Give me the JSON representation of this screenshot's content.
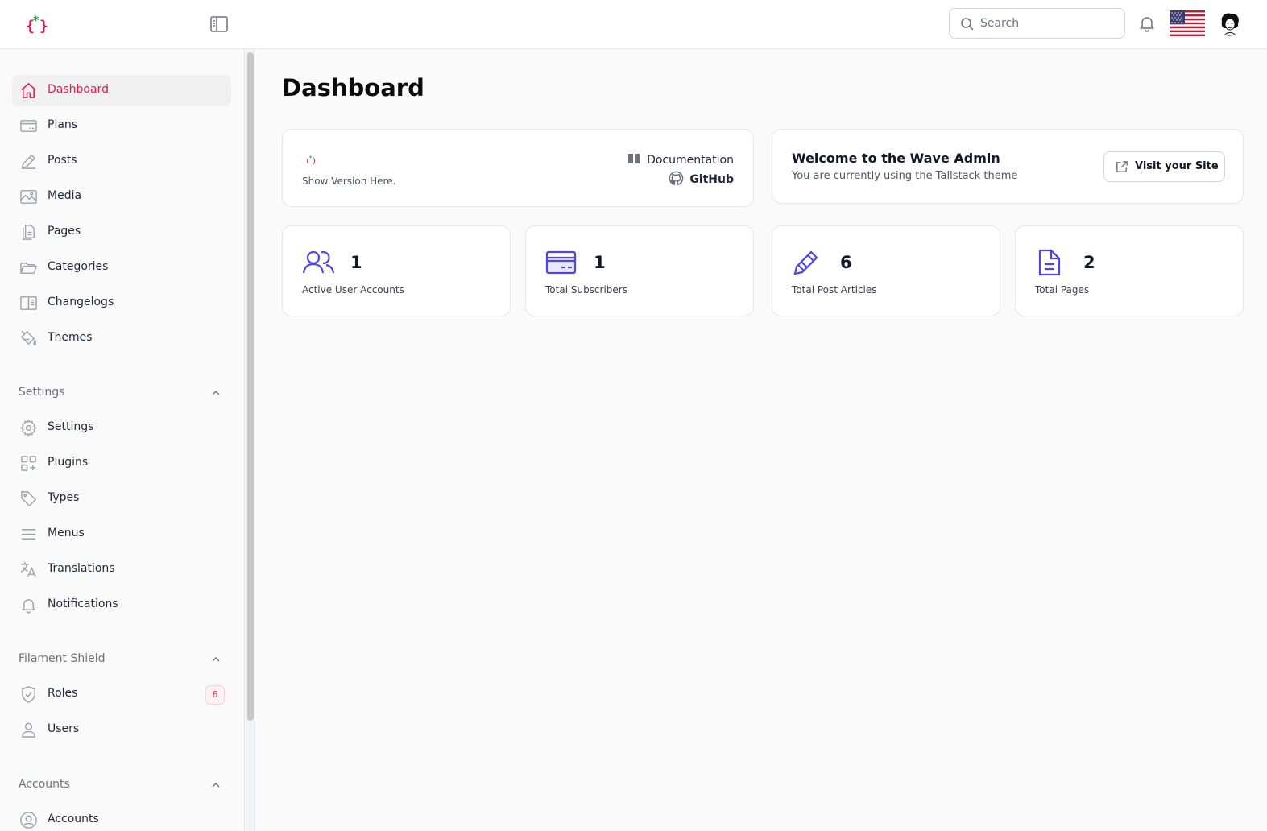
{
  "topbar": {
    "search_placeholder": "Search"
  },
  "sidebar": {
    "items": [
      {
        "label": "Dashboard"
      },
      {
        "label": "Plans"
      },
      {
        "label": "Posts"
      },
      {
        "label": "Media"
      },
      {
        "label": "Pages"
      },
      {
        "label": "Categories"
      },
      {
        "label": "Changelogs"
      },
      {
        "label": "Themes"
      }
    ],
    "settings_group": {
      "label": "Settings",
      "items": [
        {
          "label": "Settings"
        },
        {
          "label": "Plugins"
        },
        {
          "label": "Types"
        },
        {
          "label": "Menus"
        },
        {
          "label": "Translations"
        },
        {
          "label": "Notifications"
        }
      ]
    },
    "shield_group": {
      "label": "Filament Shield",
      "items": [
        {
          "label": "Roles",
          "badge": "6"
        },
        {
          "label": "Users"
        }
      ]
    },
    "accounts_group": {
      "label": "Accounts",
      "items": [
        {
          "label": "Accounts"
        }
      ]
    }
  },
  "main": {
    "title": "Dashboard",
    "info": {
      "version_text": "Show Version Here.",
      "documentation_label": "Documentation",
      "github_label": "GitHub"
    },
    "welcome": {
      "title": "Welcome to the Wave Admin",
      "subtitle": "You are currently using the Tallstack theme",
      "visit_label": "Visit your Site"
    },
    "stats": [
      {
        "value": "1",
        "label": "Active User Accounts"
      },
      {
        "value": "1",
        "label": "Total Subscribers"
      },
      {
        "value": "6",
        "label": "Total Post Articles"
      },
      {
        "value": "2",
        "label": "Total Pages"
      }
    ]
  },
  "colors": {
    "accent": "#e11d48",
    "stat_icon": "#4f46e5",
    "logo_green": "#16a34a"
  }
}
